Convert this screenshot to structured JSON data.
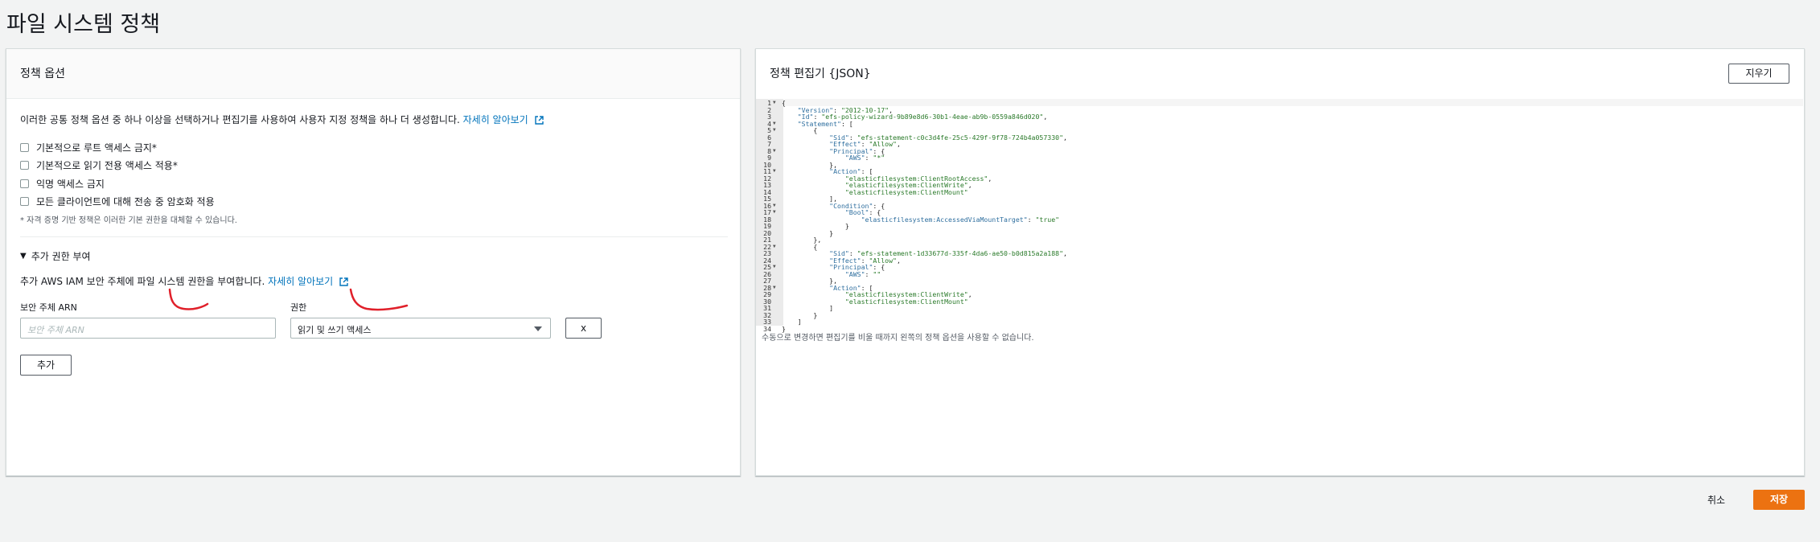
{
  "page": {
    "title": "파일 시스템 정책"
  },
  "policy_options": {
    "title": "정책 옵션",
    "description": "이러한 공통 정책 옵션 중 하나 이상을 선택하거나 편집기를 사용하여 사용자 지정 정책을 하나 더 생성합니다.",
    "learn_more": "자세히 알아보기",
    "checkboxes": [
      {
        "label": "기본적으로 루트 액세스 금지*",
        "checked": false
      },
      {
        "label": "기본적으로 읽기 전용 액세스 적용*",
        "checked": false
      },
      {
        "label": "익명 액세스 금지",
        "checked": false
      },
      {
        "label": "모든 클라이언트에 대해 전송 중 암호화 적용",
        "checked": false
      }
    ],
    "footnote": "* 자격 증명 기반 정책은 이러한 기본 권한을 대체할 수 있습니다."
  },
  "grant": {
    "title": "추가 권한 부여",
    "description": "추가 AWS IAM 보안 주체에 파일 시스템 권한을 부여합니다.",
    "learn_more": "자세히 알아보기",
    "principal_label": "보안 주체 ARN",
    "principal_placeholder": "보안 주체 ARN",
    "permission_label": "권한",
    "permission_value": "읽기 및 쓰기 액세스",
    "remove_label": "x",
    "add_label": "추가"
  },
  "editor": {
    "title": "정책 편집기 {JSON}",
    "clear_label": "지우기",
    "note": "수동으로 변경하면 편집기를 비울 때까지 왼쪽의 정책 옵션을 사용할 수 없습니다.",
    "lines": [
      {
        "n": "1",
        "fold": true,
        "text": "{"
      },
      {
        "n": "2",
        "fold": false,
        "text": "    \"Version\": \"2012-10-17\","
      },
      {
        "n": "3",
        "fold": false,
        "text": "    \"Id\": \"efs-policy-wizard-9b89e8d6-30b1-4eae-ab9b-0559a846d020\","
      },
      {
        "n": "4",
        "fold": true,
        "text": "    \"Statement\": ["
      },
      {
        "n": "5",
        "fold": true,
        "text": "        {"
      },
      {
        "n": "6",
        "fold": false,
        "text": "            \"Sid\": \"efs-statement-c0c3d4fe-25c5-429f-9f78-724b4a057330\","
      },
      {
        "n": "7",
        "fold": false,
        "text": "            \"Effect\": \"Allow\","
      },
      {
        "n": "8",
        "fold": true,
        "text": "            \"Principal\": {"
      },
      {
        "n": "9",
        "fold": false,
        "text": "                \"AWS\": \"*\""
      },
      {
        "n": "10",
        "fold": false,
        "text": "            },"
      },
      {
        "n": "11",
        "fold": true,
        "text": "            \"Action\": ["
      },
      {
        "n": "12",
        "fold": false,
        "text": "                \"elasticfilesystem:ClientRootAccess\","
      },
      {
        "n": "13",
        "fold": false,
        "text": "                \"elasticfilesystem:ClientWrite\","
      },
      {
        "n": "14",
        "fold": false,
        "text": "                \"elasticfilesystem:ClientMount\""
      },
      {
        "n": "15",
        "fold": false,
        "text": "            ],"
      },
      {
        "n": "16",
        "fold": true,
        "text": "            \"Condition\": {"
      },
      {
        "n": "17",
        "fold": true,
        "text": "                \"Bool\": {"
      },
      {
        "n": "18",
        "fold": false,
        "text": "                    \"elasticfilesystem:AccessedViaMountTarget\": \"true\""
      },
      {
        "n": "19",
        "fold": false,
        "text": "                }"
      },
      {
        "n": "20",
        "fold": false,
        "text": "            }"
      },
      {
        "n": "21",
        "fold": false,
        "text": "        },"
      },
      {
        "n": "22",
        "fold": true,
        "text": "        {"
      },
      {
        "n": "23",
        "fold": false,
        "text": "            \"Sid\": \"efs-statement-1d33677d-335f-4da6-ae50-b0d815a2a188\","
      },
      {
        "n": "24",
        "fold": false,
        "text": "            \"Effect\": \"Allow\","
      },
      {
        "n": "25",
        "fold": true,
        "text": "            \"Principal\": {"
      },
      {
        "n": "26",
        "fold": false,
        "text": "                \"AWS\": \"\""
      },
      {
        "n": "27",
        "fold": false,
        "text": "            },"
      },
      {
        "n": "28",
        "fold": true,
        "text": "            \"Action\": ["
      },
      {
        "n": "29",
        "fold": false,
        "text": "                \"elasticfilesystem:ClientWrite\","
      },
      {
        "n": "30",
        "fold": false,
        "text": "                \"elasticfilesystem:ClientMount\""
      },
      {
        "n": "31",
        "fold": false,
        "text": "            ]"
      },
      {
        "n": "32",
        "fold": false,
        "text": "        }"
      },
      {
        "n": "33",
        "fold": false,
        "text": "    ]"
      },
      {
        "n": "34",
        "fold": false,
        "text": "}"
      }
    ]
  },
  "footer": {
    "cancel_label": "취소",
    "save_label": "저장"
  },
  "colors": {
    "link": "#0073bb",
    "primary": "#ec7211",
    "annotation": "#e0202a"
  }
}
